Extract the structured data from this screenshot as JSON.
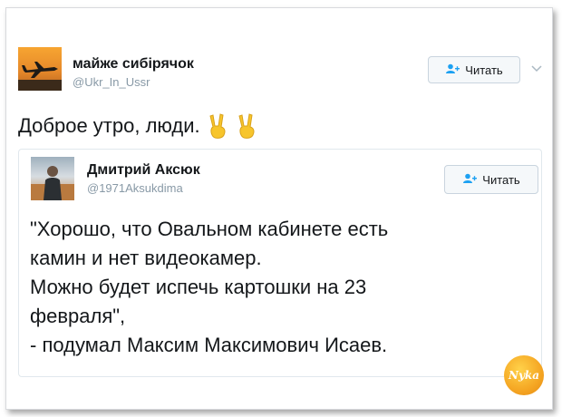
{
  "tweet": {
    "author": {
      "name": "майже сибірячок",
      "handle": "@Ukr_In_Ussr"
    },
    "follow_label": "Читать",
    "text": "Доброе утро, люди.",
    "emoji": [
      "victory-hand-emoji",
      "victory-hand-emoji"
    ]
  },
  "quoted": {
    "author": {
      "name": "Дмитрий Аксюк",
      "handle": "@1971Aksukdima"
    },
    "follow_label": "Читать",
    "lines": [
      "\"Хорошо, что Овальном кабинете есть",
      "камин и нет видеокамер.",
      "Можно будет испечь картошки на 23",
      "февраля\",",
      "- подумал Максим Максимович Исаев."
    ]
  },
  "watermark": "Nyka",
  "colors": {
    "handle": "#8899a6",
    "border": "#e1e8ed",
    "button_bg": "#f5f8fa",
    "emoji": "#f7c52c"
  }
}
